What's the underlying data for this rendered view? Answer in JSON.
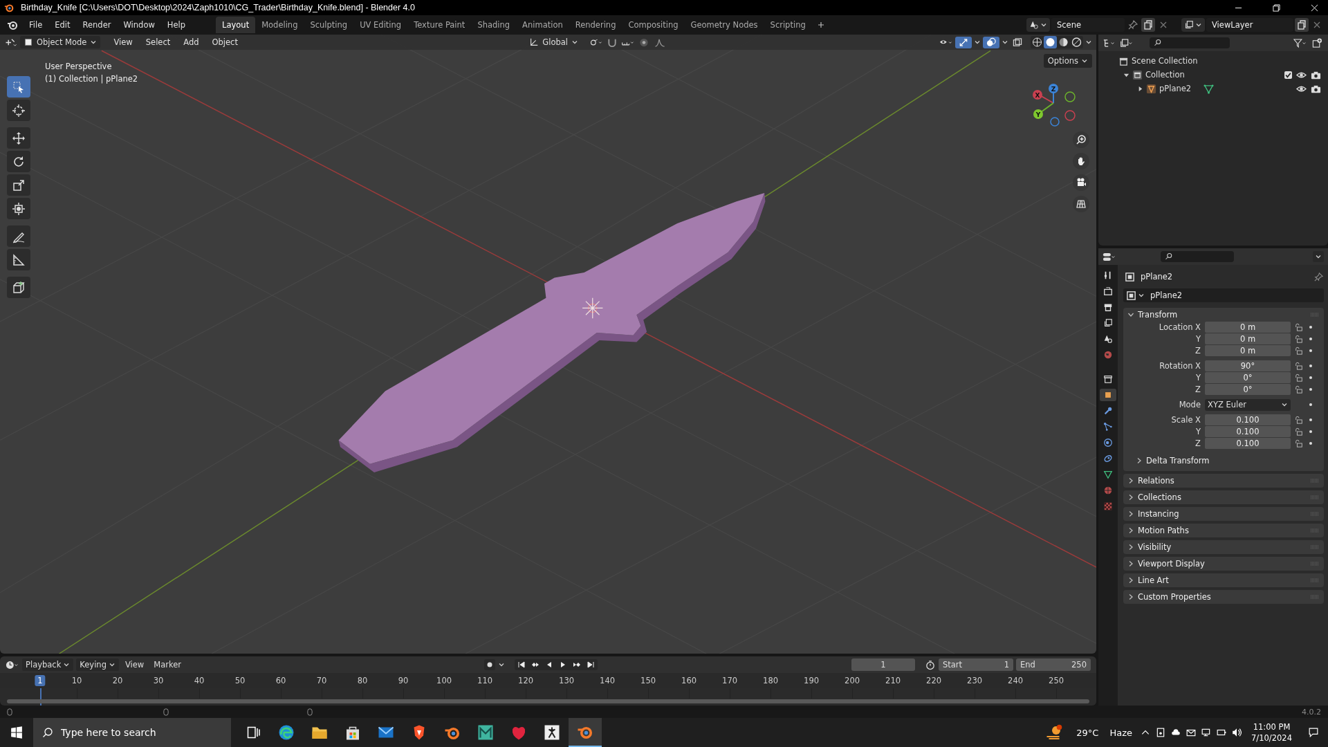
{
  "window": {
    "title": "Birthday_Knife [C:\\Users\\DOT\\Desktop\\2024\\Zaph1010\\CG_Trader\\Birthday_Knife.blend] - Blender 4.0"
  },
  "menu": [
    "File",
    "Edit",
    "Render",
    "Window",
    "Help"
  ],
  "workspaces": [
    {
      "label": "Layout",
      "selected": true
    },
    {
      "label": "Modeling",
      "selected": false
    },
    {
      "label": "Sculpting",
      "selected": false
    },
    {
      "label": "UV Editing",
      "selected": false
    },
    {
      "label": "Texture Paint",
      "selected": false
    },
    {
      "label": "Shading",
      "selected": false
    },
    {
      "label": "Animation",
      "selected": false
    },
    {
      "label": "Rendering",
      "selected": false
    },
    {
      "label": "Compositing",
      "selected": false
    },
    {
      "label": "Geometry Nodes",
      "selected": false
    },
    {
      "label": "Scripting",
      "selected": false
    }
  ],
  "scene": {
    "scene": "Scene",
    "view_layer": "ViewLayer"
  },
  "viewport_header": {
    "mode": "Object Mode",
    "menus": [
      "View",
      "Select",
      "Add",
      "Object"
    ],
    "orientation": "Global"
  },
  "viewport": {
    "info": [
      "User Perspective",
      "(1) Collection | pPlane2"
    ],
    "options": "Options",
    "gizmo_axes": [
      "X",
      "Y",
      "Z"
    ]
  },
  "tools": [
    {
      "kind": "select",
      "selected": true
    },
    {
      "kind": "cursor",
      "selected": false
    },
    {
      "kind": "move",
      "selected": false
    },
    {
      "kind": "rotate",
      "selected": false
    },
    {
      "kind": "scale",
      "selected": false
    },
    {
      "kind": "transform",
      "selected": false
    },
    {
      "kind": "annotate",
      "selected": false
    },
    {
      "kind": "measure",
      "selected": false
    },
    {
      "kind": "cube",
      "selected": false
    }
  ],
  "outliner": {
    "items": [
      {
        "label": "Scene Collection",
        "kind": "scene",
        "children": [
          {
            "label": "Collection",
            "kind": "collection",
            "expanded": true,
            "checked": true,
            "children": [
              {
                "label": "pPlane2",
                "kind": "mesh",
                "expanded": false
              }
            ]
          }
        ]
      }
    ]
  },
  "property_tabs": [
    {
      "kind": "tool",
      "selected": false
    },
    {
      "kind": "render",
      "selected": false
    },
    {
      "kind": "output",
      "selected": false
    },
    {
      "kind": "view_layer",
      "selected": false
    },
    {
      "kind": "scene",
      "selected": false
    },
    {
      "kind": "world",
      "selected": false
    },
    {
      "kind": "collection",
      "selected": false
    },
    {
      "kind": "object",
      "selected": true
    },
    {
      "kind": "modifier",
      "selected": false
    },
    {
      "kind": "particles",
      "selected": false
    },
    {
      "kind": "physics",
      "selected": false
    },
    {
      "kind": "constraint",
      "selected": false
    },
    {
      "kind": "data",
      "selected": false
    },
    {
      "kind": "material",
      "selected": false
    },
    {
      "kind": "texture",
      "selected": false
    }
  ],
  "properties": {
    "object_name": "pPlane2",
    "data_name": "pPlane2",
    "transform": {
      "title": "Transform",
      "expanded": true,
      "groups": [
        {
          "rows": [
            {
              "label": "Location X",
              "value": "0 m",
              "kind": "field"
            },
            {
              "label": "Y",
              "value": "0 m",
              "kind": "field"
            },
            {
              "label": "Z",
              "value": "0 m",
              "kind": "field"
            }
          ]
        },
        {
          "rows": [
            {
              "label": "Rotation X",
              "value": "90°",
              "kind": "field"
            },
            {
              "label": "Y",
              "value": "0°",
              "kind": "field"
            },
            {
              "label": "Z",
              "value": "0°",
              "kind": "field"
            }
          ]
        },
        {
          "rows": [
            {
              "label": "Mode",
              "value": "XYZ Euler",
              "kind": "select"
            }
          ]
        },
        {
          "rows": [
            {
              "label": "Scale X",
              "value": "0.100",
              "kind": "field"
            },
            {
              "label": "Y",
              "value": "0.100",
              "kind": "field"
            },
            {
              "label": "Z",
              "value": "0.100",
              "kind": "field"
            }
          ]
        }
      ],
      "subpanel": {
        "title": "Delta Transform",
        "expanded": false
      }
    },
    "panels": [
      {
        "title": "Relations",
        "expanded": false
      },
      {
        "title": "Collections",
        "expanded": false
      },
      {
        "title": "Instancing",
        "expanded": false
      },
      {
        "title": "Motion Paths",
        "expanded": false
      },
      {
        "title": "Visibility",
        "expanded": false
      },
      {
        "title": "Viewport Display",
        "expanded": false
      },
      {
        "title": "Line Art",
        "expanded": false
      },
      {
        "title": "Custom Properties",
        "expanded": false
      }
    ]
  },
  "timeline": {
    "menus": [
      "Playback",
      "Keying",
      "View",
      "Marker"
    ],
    "current_frame": "1",
    "start_label": "Start",
    "start": "1",
    "end_label": "End",
    "end": "250",
    "ticks": [
      {
        "label": "1",
        "selected": true
      },
      {
        "label": "10",
        "selected": false
      },
      {
        "label": "20",
        "selected": false
      },
      {
        "label": "30",
        "selected": false
      },
      {
        "label": "40",
        "selected": false
      },
      {
        "label": "50",
        "selected": false
      },
      {
        "label": "60",
        "selected": false
      },
      {
        "label": "70",
        "selected": false
      },
      {
        "label": "80",
        "selected": false
      },
      {
        "label": "90",
        "selected": false
      },
      {
        "label": "100",
        "selected": false
      },
      {
        "label": "110",
        "selected": false
      },
      {
        "label": "120",
        "selected": false
      },
      {
        "label": "130",
        "selected": false
      },
      {
        "label": "140",
        "selected": false
      },
      {
        "label": "150",
        "selected": false
      },
      {
        "label": "160",
        "selected": false
      },
      {
        "label": "170",
        "selected": false
      },
      {
        "label": "180",
        "selected": false
      },
      {
        "label": "190",
        "selected": false
      },
      {
        "label": "200",
        "selected": false
      },
      {
        "label": "210",
        "selected": false
      },
      {
        "label": "220",
        "selected": false
      },
      {
        "label": "230",
        "selected": false
      },
      {
        "label": "240",
        "selected": false
      },
      {
        "label": "250",
        "selected": false
      }
    ]
  },
  "status_bar": {
    "version": "4.0.2"
  },
  "taskbar": {
    "search_placeholder": "Type here to search",
    "temperature": "29°C",
    "weather": "Haze",
    "time": "11:00 PM",
    "date": "7/10/2024"
  }
}
